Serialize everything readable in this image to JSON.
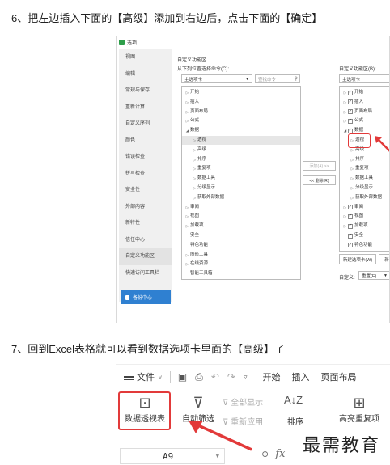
{
  "step6": "6、把左边插入下面的【高级】添加到右边后，点击下面的【确定】",
  "step7": "7、回到Excel表格就可以看到数据选项卡里面的【高级】了",
  "dialog": {
    "title": "选项",
    "sidebar": [
      "视图",
      "编辑",
      "常规与保存",
      "重新计算",
      "自定义序列",
      "颜色",
      "错误检查",
      "拼写检查",
      "安全性",
      "外部内容",
      "新特性",
      "信任中心",
      "自定义功能区",
      "快速访问工具栏"
    ],
    "backup_label": "备份中心",
    "section_title": "自定义功能区",
    "left_label": "从下列位置选择命令(C):",
    "left_select": "主选项卡",
    "search_placeholder": "查找命令",
    "left_tree": [
      {
        "label": "开始",
        "indent": 1,
        "arrow": "▷"
      },
      {
        "label": "插入",
        "indent": 1,
        "arrow": "▷"
      },
      {
        "label": "页面布局",
        "indent": 1,
        "arrow": "▷"
      },
      {
        "label": "公式",
        "indent": 1,
        "arrow": "▷"
      },
      {
        "label": "数据",
        "indent": 1,
        "arrow": "◢"
      },
      {
        "label": "透视",
        "indent": 2,
        "arrow": "▷",
        "selected": true
      },
      {
        "label": "高级",
        "indent": 2,
        "arrow": "▷"
      },
      {
        "label": "排序",
        "indent": 2,
        "arrow": "▷"
      },
      {
        "label": "重复项",
        "indent": 2,
        "arrow": "▷"
      },
      {
        "label": "数据工具",
        "indent": 2,
        "arrow": "▷"
      },
      {
        "label": "分级显示",
        "indent": 2,
        "arrow": "▷"
      },
      {
        "label": "获取外部数据",
        "indent": 2,
        "arrow": "▷"
      },
      {
        "label": "审阅",
        "indent": 1,
        "arrow": "▷"
      },
      {
        "label": "视图",
        "indent": 1,
        "arrow": "▷"
      },
      {
        "label": "加载项",
        "indent": 1,
        "arrow": "▷"
      },
      {
        "label": "安全",
        "indent": 1,
        "arrow": ""
      },
      {
        "label": "特色功能",
        "indent": 1,
        "arrow": ""
      },
      {
        "label": "图形工具",
        "indent": 1,
        "arrow": "▷"
      },
      {
        "label": "在线资源",
        "indent": 1,
        "arrow": "▷"
      },
      {
        "label": "智能工具箱",
        "indent": 1,
        "arrow": ""
      }
    ],
    "add_button": "添加(A) >>",
    "remove_button": "<< 删除(R)",
    "right_label": "自定义功能区(B):",
    "right_select": "主选项卡",
    "right_tree": [
      {
        "label": "开始",
        "indent": 1,
        "arrow": "▷",
        "check": true
      },
      {
        "label": "插入",
        "indent": 1,
        "arrow": "▷",
        "check": true
      },
      {
        "label": "页面布局",
        "indent": 1,
        "arrow": "▷",
        "check": true
      },
      {
        "label": "公式",
        "indent": 1,
        "arrow": "▷",
        "check": true
      },
      {
        "label": "数据",
        "indent": 1,
        "arrow": "◢",
        "check": true
      },
      {
        "label": "透视",
        "indent": 2,
        "arrow": "▷"
      },
      {
        "label": "高级",
        "indent": 2,
        "arrow": "▷"
      },
      {
        "label": "排序",
        "indent": 2,
        "arrow": "▷"
      },
      {
        "label": "重复项",
        "indent": 2,
        "arrow": "▷"
      },
      {
        "label": "数据工具",
        "indent": 2,
        "arrow": "▷"
      },
      {
        "label": "分级显示",
        "indent": 2,
        "arrow": "▷"
      },
      {
        "label": "获取外部数据",
        "indent": 2,
        "arrow": "▷"
      },
      {
        "label": "审阅",
        "indent": 1,
        "arrow": "▷",
        "check": true
      },
      {
        "label": "视图",
        "indent": 1,
        "arrow": "▷",
        "check": true
      },
      {
        "label": "加载项",
        "indent": 1,
        "arrow": "▷",
        "check": true
      },
      {
        "label": "安全",
        "indent": 1,
        "arrow": "",
        "check": true
      },
      {
        "label": "特色功能",
        "indent": 1,
        "arrow": "",
        "check": true
      }
    ],
    "new_tab_button": "新建选项卡(W)",
    "new_group_button": "新",
    "customize_label": "自定义:",
    "reset_select": "重置(E)"
  },
  "ribbon": {
    "file_menu": "文件",
    "tabs": [
      "开始",
      "插入",
      "页面布局"
    ],
    "pivot": "数据透视表",
    "autofilter": "自动筛选",
    "show_all": "全部显示",
    "reapply": "重新应用",
    "sort": "排序",
    "highlight_dup": "高亮重复项",
    "cell_ref": "A9",
    "fx": "fx",
    "watermark": "最需教育"
  }
}
